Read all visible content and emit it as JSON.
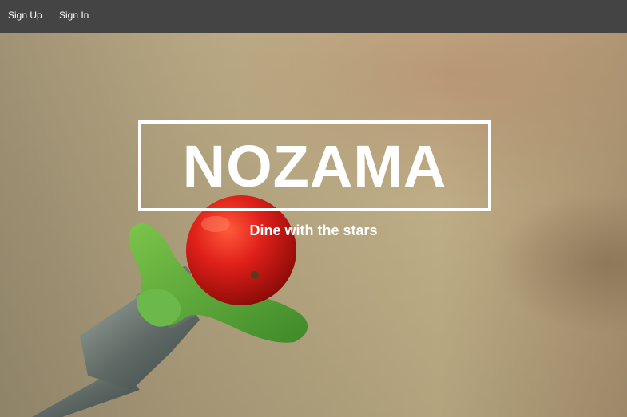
{
  "nav": {
    "sign_up": "Sign Up",
    "sign_in": "Sign In"
  },
  "hero": {
    "title": "NOZAMA",
    "tagline": "Dine with the stars"
  },
  "colors": {
    "navbar_bg": "#444444",
    "hero_tone": "#c9b48a",
    "tomato": "#d41a10",
    "lettuce": "#5aa83a",
    "text": "#ffffff"
  },
  "icons": {
    "hero_image": "fork-with-tomato-and-lettuce"
  }
}
